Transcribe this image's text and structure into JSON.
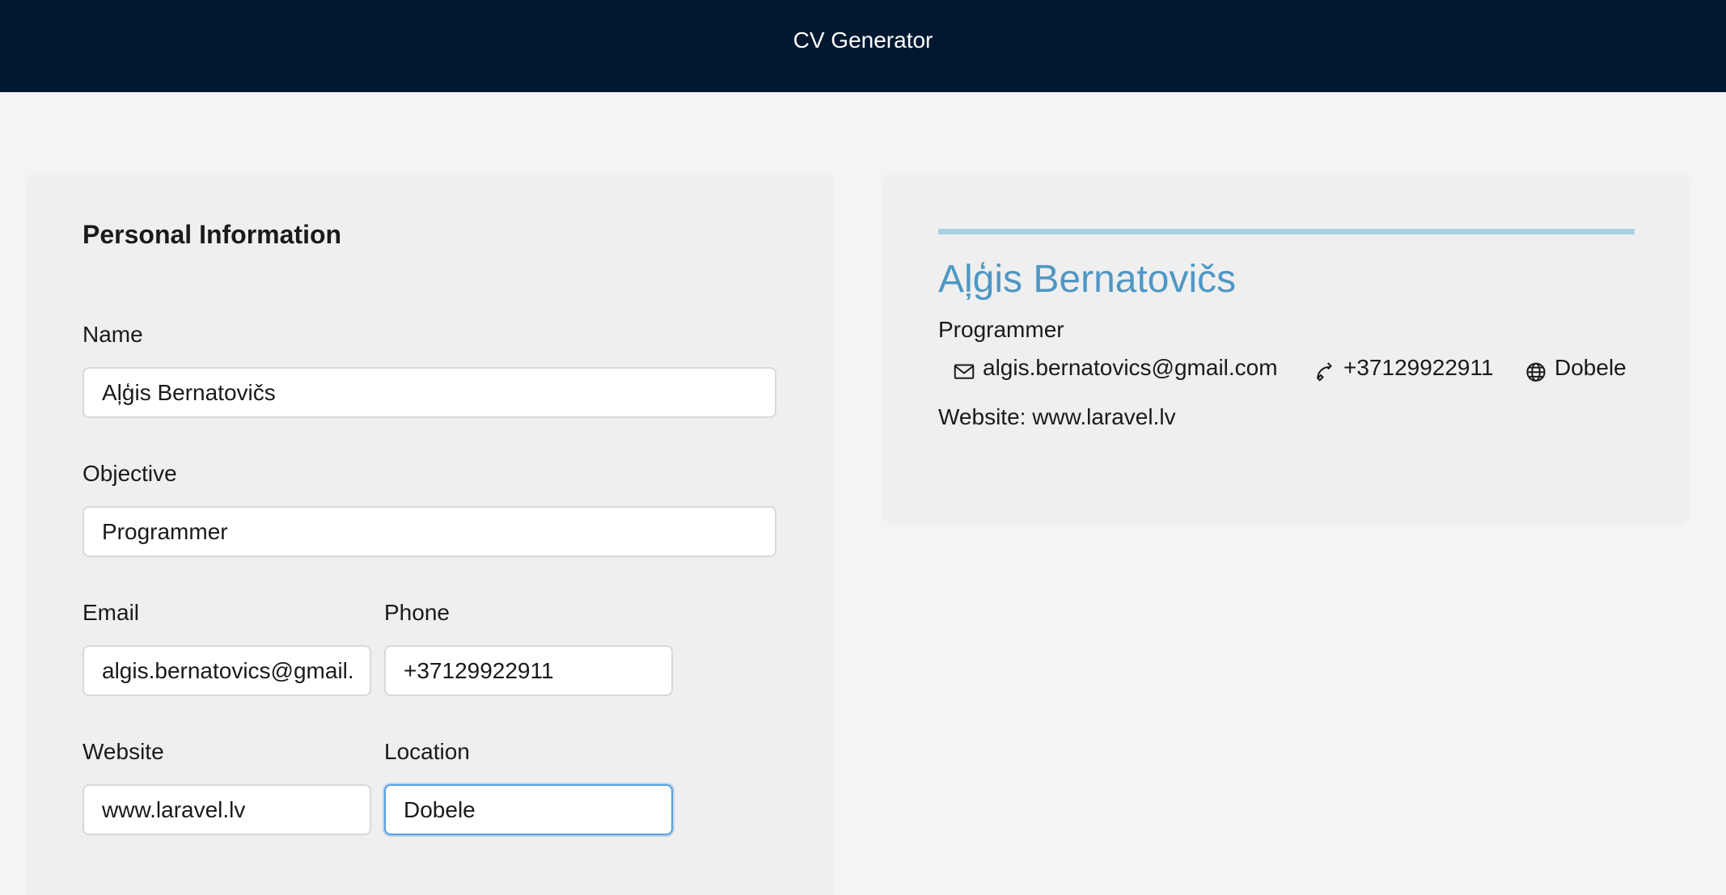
{
  "header": {
    "title": "CV Generator"
  },
  "form": {
    "section_title": "Personal Information",
    "name": {
      "label": "Name",
      "value": "Aļģis Bernatovičs"
    },
    "objective": {
      "label": "Objective",
      "value": "Programmer"
    },
    "email": {
      "label": "Email",
      "value": "algis.bernatovics@gmail.com"
    },
    "phone": {
      "label": "Phone",
      "value": "+37129922911"
    },
    "website": {
      "label": "Website",
      "value": "www.laravel.lv"
    },
    "location": {
      "label": "Location",
      "value": "Dobele"
    }
  },
  "preview": {
    "name": "Aļģis Bernatovičs",
    "objective": "Programmer",
    "email": "algis.bernatovics@gmail.com",
    "phone": "+37129922911",
    "location": "Dobele",
    "website_line": "Website: www.laravel.lv",
    "accent_color": "#a8d2e4",
    "name_color": "#4f97c4",
    "icons": {
      "email": "envelope-icon",
      "phone": "phone-icon",
      "location": "globe-icon"
    }
  },
  "colors": {
    "header_bg": "#001830",
    "page_bg": "#f4f4f4",
    "panel_bg": "#efefef",
    "focus_border": "#5aa0e0"
  }
}
